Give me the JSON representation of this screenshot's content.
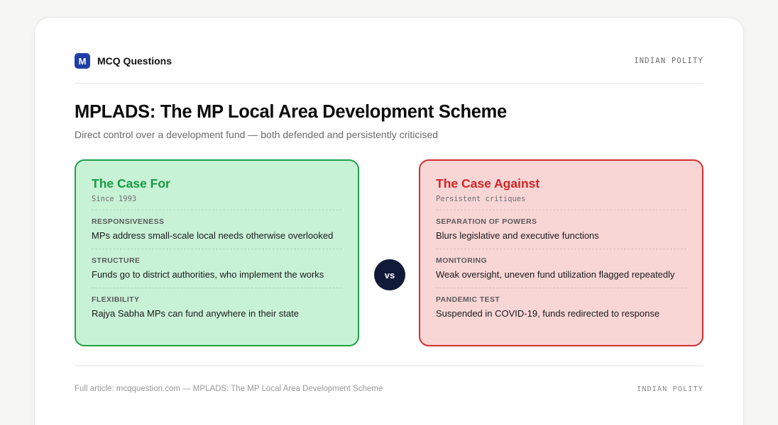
{
  "brand": {
    "logo_letter": "M",
    "name": "MCQ Questions"
  },
  "category_tag": "INDIAN POLITY",
  "title": "MPLADS: The MP Local Area Development Scheme",
  "subtitle": "Direct control over a development fund — both defended and persistently criticised",
  "vs_label": "vs",
  "case_for": {
    "title": "The Case For",
    "subtitle": "Since 1993",
    "items": [
      {
        "label": "RESPONSIVENESS",
        "text": "MPs address small-scale local needs otherwise overlooked"
      },
      {
        "label": "STRUCTURE",
        "text": "Funds go to district authorities, who implement the works"
      },
      {
        "label": "FLEXIBILITY",
        "text": "Rajya Sabha MPs can fund anywhere in their state"
      }
    ]
  },
  "case_against": {
    "title": "The Case Against",
    "subtitle": "Persistent critiques",
    "items": [
      {
        "label": "SEPARATION OF POWERS",
        "text": "Blurs legislative and executive functions"
      },
      {
        "label": "MONITORING",
        "text": "Weak oversight, uneven fund utilization flagged repeatedly"
      },
      {
        "label": "PANDEMIC TEST",
        "text": "Suspended in COVID-19, funds redirected to response"
      }
    ]
  },
  "footer": {
    "text": "Full article: mcqquestion.com — MPLADS: The MP Local Area Development Scheme",
    "tag": "INDIAN POLITY"
  },
  "colors": {
    "brand_blue": "#1f3fa8",
    "for_green": "#1fa148",
    "for_bg": "#c8f2d6",
    "against_red": "#d03030",
    "against_bg": "#f9d6d6",
    "vs_navy": "#121a3a"
  }
}
